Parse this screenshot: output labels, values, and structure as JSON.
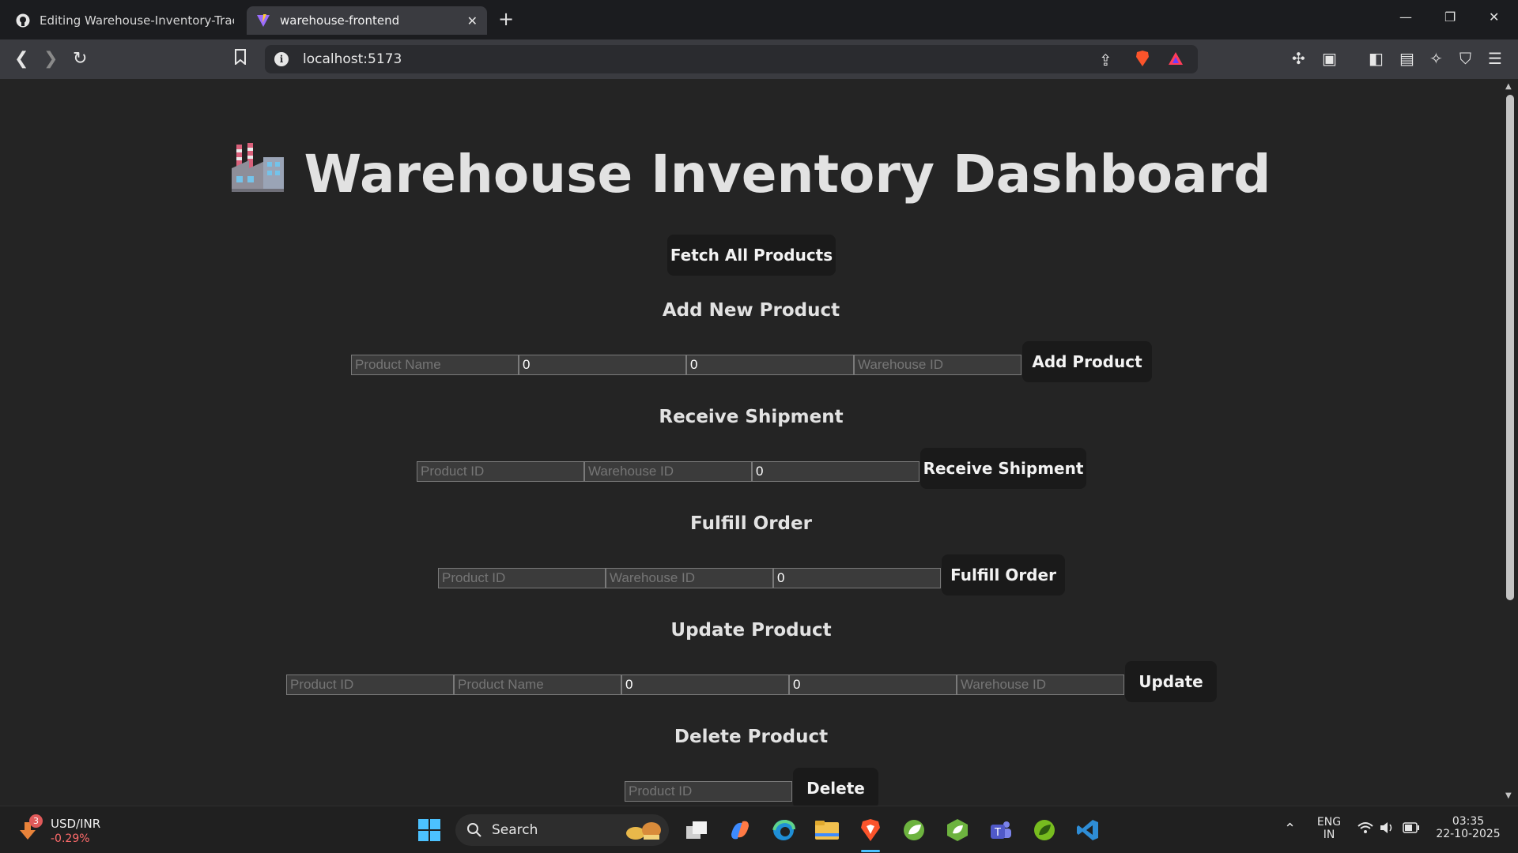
{
  "browser": {
    "tabs": [
      {
        "title": "Editing Warehouse-Inventory-Tracker",
        "favicon": "github-icon"
      },
      {
        "title": "warehouse-frontend",
        "favicon": "vite-icon"
      }
    ],
    "url": "localhost:5173"
  },
  "page": {
    "title": "Warehouse Inventory Dashboard",
    "fetch_button": "Fetch All Products",
    "add": {
      "heading": "Add New Product",
      "name_placeholder": "Product Name",
      "qty_value": "0",
      "price_value": "0",
      "warehouse_placeholder": "Warehouse ID",
      "button": "Add Product"
    },
    "receive": {
      "heading": "Receive Shipment",
      "product_placeholder": "Product ID",
      "warehouse_placeholder": "Warehouse ID",
      "qty_value": "0",
      "button": "Receive Shipment"
    },
    "fulfill": {
      "heading": "Fulfill Order",
      "product_placeholder": "Product ID",
      "warehouse_placeholder": "Warehouse ID",
      "qty_value": "0",
      "button": "Fulfill Order"
    },
    "update": {
      "heading": "Update Product",
      "product_placeholder": "Product ID",
      "name_placeholder": "Product Name",
      "qty_value": "0",
      "price_value": "0",
      "warehouse_placeholder": "Warehouse ID",
      "button": "Update"
    },
    "delete": {
      "heading": "Delete Product",
      "product_placeholder": "Product ID",
      "button": "Delete"
    }
  },
  "taskbar": {
    "widget": {
      "badge": "3",
      "title": "USD/INR",
      "change": "-0.29%"
    },
    "search_label": "Search",
    "lang": {
      "line1": "ENG",
      "line2": "IN"
    },
    "clock": {
      "time": "03:35",
      "date": "22-10-2025"
    }
  },
  "colors": {
    "page_bg": "#242424",
    "button_bg": "#1a1a1a",
    "toolbar_bg": "#3a3b40",
    "change_red": "#ff6b6b"
  }
}
